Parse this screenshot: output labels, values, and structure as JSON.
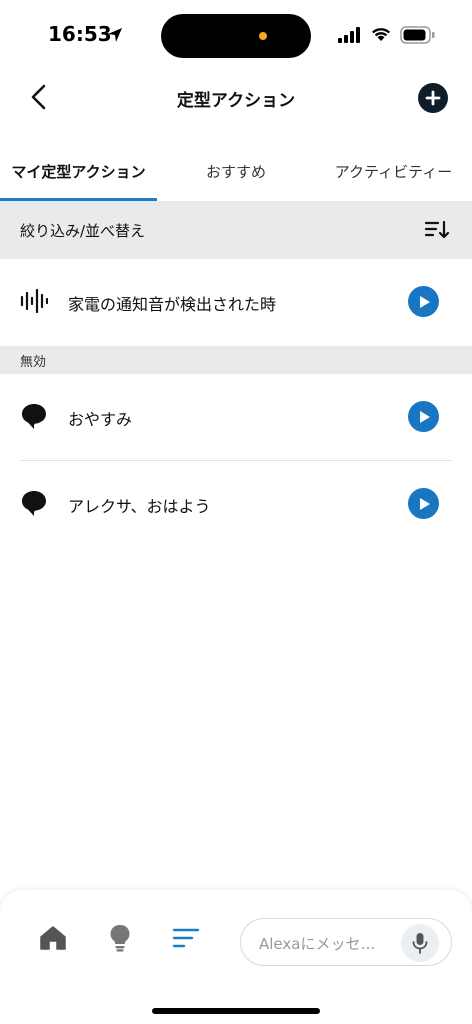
{
  "status": {
    "time": "16:53"
  },
  "header": {
    "title": "定型アクション",
    "back_icon": "chevron-left-icon",
    "add_icon": "plus-circle-icon"
  },
  "tabs": [
    {
      "label": "マイ定型アクション",
      "active": true
    },
    {
      "label": "おすすめ",
      "active": false
    },
    {
      "label": "アクティビティー",
      "active": false
    }
  ],
  "filter": {
    "label": "絞り込み/並べ替え",
    "icon": "sort-icon"
  },
  "routines": [
    {
      "label": "家電の通知音が検出された時",
      "icon": "sound-wave-icon"
    }
  ],
  "disabled_section": {
    "label": "無効",
    "routines": [
      {
        "label": "おやすみ",
        "icon": "speech-bubble-icon"
      },
      {
        "label": "アレクサ、おはよう",
        "icon": "speech-bubble-icon"
      }
    ]
  },
  "bottom_nav": {
    "items": [
      "home-icon",
      "lightbulb-icon",
      "routines-icon"
    ],
    "alexa_placeholder": "Alexaにメッセ…",
    "mic_icon": "microphone-icon"
  },
  "colors": {
    "accent": "#1c7fc5",
    "play": "#1976c2",
    "filter_bg": "#e8eaeb",
    "add_button": "#0f1d2a"
  }
}
